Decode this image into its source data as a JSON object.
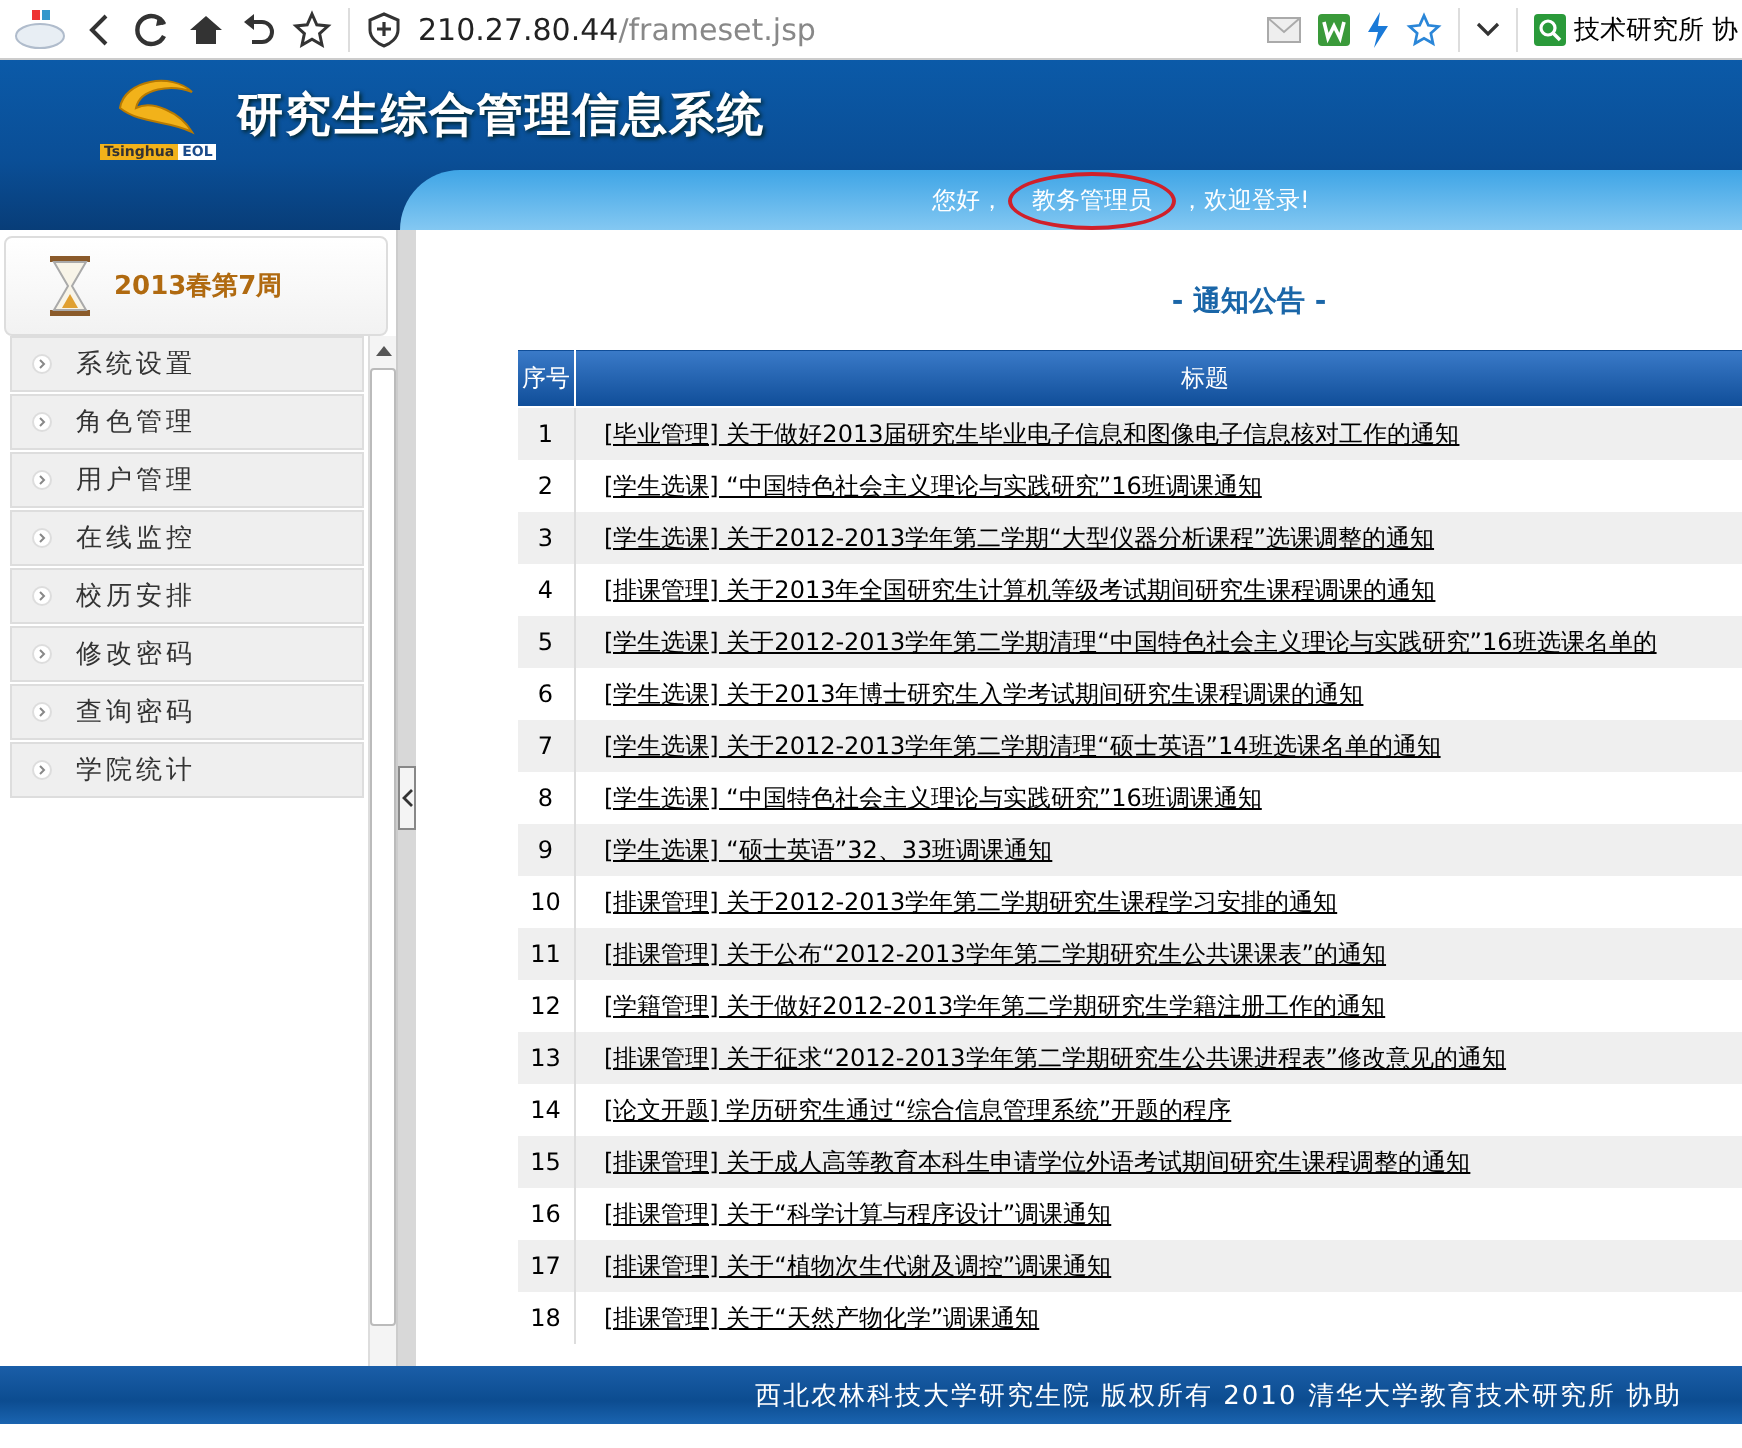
{
  "browser": {
    "url_host": "210.27.80.44",
    "url_path": "/frameset.jsp",
    "search_text": "技术研究所 协"
  },
  "header": {
    "logo_brand": "Tsinghua",
    "logo_sub": "EOL",
    "system_title": "研究生综合管理信息系统",
    "welcome_prefix": "您好，",
    "welcome_name": "教务管理员",
    "welcome_suffix": "，欢迎登录!"
  },
  "sidebar": {
    "week": "2013春第7周",
    "items": [
      {
        "label": "系统设置"
      },
      {
        "label": "角色管理"
      },
      {
        "label": "用户管理"
      },
      {
        "label": "在线监控"
      },
      {
        "label": "校历安排"
      },
      {
        "label": "修改密码"
      },
      {
        "label": "查询密码"
      },
      {
        "label": "学院统计"
      }
    ]
  },
  "notices": {
    "title": "- 通知公告 -",
    "columns": [
      "序号",
      "标题"
    ],
    "rows": [
      {
        "index": "1",
        "title": "[毕业管理] 关于做好2013届研究生毕业电子信息和图像电子信息核对工作的通知"
      },
      {
        "index": "2",
        "title": "[学生选课] “中国特色社会主义理论与实践研究”16班调课通知"
      },
      {
        "index": "3",
        "title": "[学生选课] 关于2012-2013学年第二学期“大型仪器分析课程”选课调整的通知"
      },
      {
        "index": "4",
        "title": "[排课管理] 关于2013年全国研究生计算机等级考试期间研究生课程调课的通知"
      },
      {
        "index": "5",
        "title": "[学生选课] 关于2012-2013学年第二学期清理“中国特色社会主义理论与实践研究”16班选课名单的"
      },
      {
        "index": "6",
        "title": "[学生选课] 关于2013年博士研究生入学考试期间研究生课程调课的通知"
      },
      {
        "index": "7",
        "title": "[学生选课] 关于2012-2013学年第二学期清理“硕士英语”14班选课名单的通知"
      },
      {
        "index": "8",
        "title": "[学生选课] “中国特色社会主义理论与实践研究”16班调课通知"
      },
      {
        "index": "9",
        "title": "[学生选课] “硕士英语”32、33班调课通知"
      },
      {
        "index": "10",
        "title": "[排课管理] 关于2012-2013学年第二学期研究生课程学习安排的通知"
      },
      {
        "index": "11",
        "title": "[排课管理] 关于公布“2012-2013学年第二学期研究生公共课课表”的通知"
      },
      {
        "index": "12",
        "title": "[学籍管理] 关于做好2012-2013学年第二学期研究生学籍注册工作的通知"
      },
      {
        "index": "13",
        "title": "[排课管理] 关于征求“2012-2013学年第二学期研究生公共课进程表”修改意见的通知"
      },
      {
        "index": "14",
        "title": "[论文开题] 学历研究生通过“综合信息管理系统”开题的程序"
      },
      {
        "index": "15",
        "title": "[排课管理] 关于成人高等教育本科生申请学位外语考试期间研究生课程调整的通知"
      },
      {
        "index": "16",
        "title": "[排课管理] 关于“科学计算与程序设计”调课通知"
      },
      {
        "index": "17",
        "title": "[排课管理] 关于“植物次生代谢及调控”调课通知"
      },
      {
        "index": "18",
        "title": "[排课管理] 关于“天然产物化学”调课通知"
      }
    ]
  },
  "footer": "西北农林科技大学研究生院 版权所有 2010 清华大学教育技术研究所 协助"
}
